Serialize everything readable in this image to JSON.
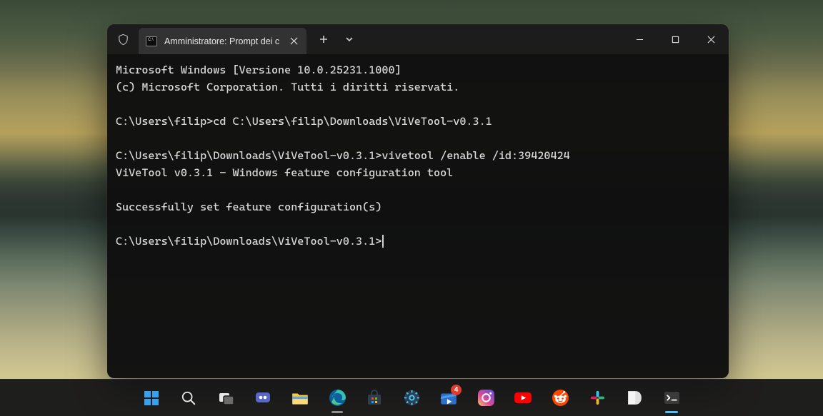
{
  "window": {
    "tab_title": "Amministratore: Prompt dei c",
    "tab_icon_text": "C:\\"
  },
  "terminal": {
    "line_version": "Microsoft Windows [Versione 10.0.25231.1000]",
    "line_copyright": "(c) Microsoft Corporation. Tutti i diritti riservati.",
    "prompt1": "C:\\Users\\filip>",
    "cmd1": "cd C:\\Users\\filip\\Downloads\\ViVeTool-v0.3.1",
    "prompt2": "C:\\Users\\filip\\Downloads\\ViVeTool-v0.3.1>",
    "cmd2": "vivetool /enable /id:39420424",
    "out_tool": "ViVeTool v0.3.1 - Windows feature configuration tool",
    "out_success": "Successfully set feature configuration(s)",
    "prompt3": "C:\\Users\\filip\\Downloads\\ViVeTool-v0.3.1>"
  },
  "taskbar": {
    "badge_count": "4",
    "items": [
      "start",
      "search",
      "task-view",
      "chat",
      "file-explorer",
      "edge",
      "microsoft-store",
      "settings",
      "movies-tv",
      "instagram",
      "youtube",
      "reddit",
      "slack",
      "devhome",
      "terminal"
    ]
  }
}
